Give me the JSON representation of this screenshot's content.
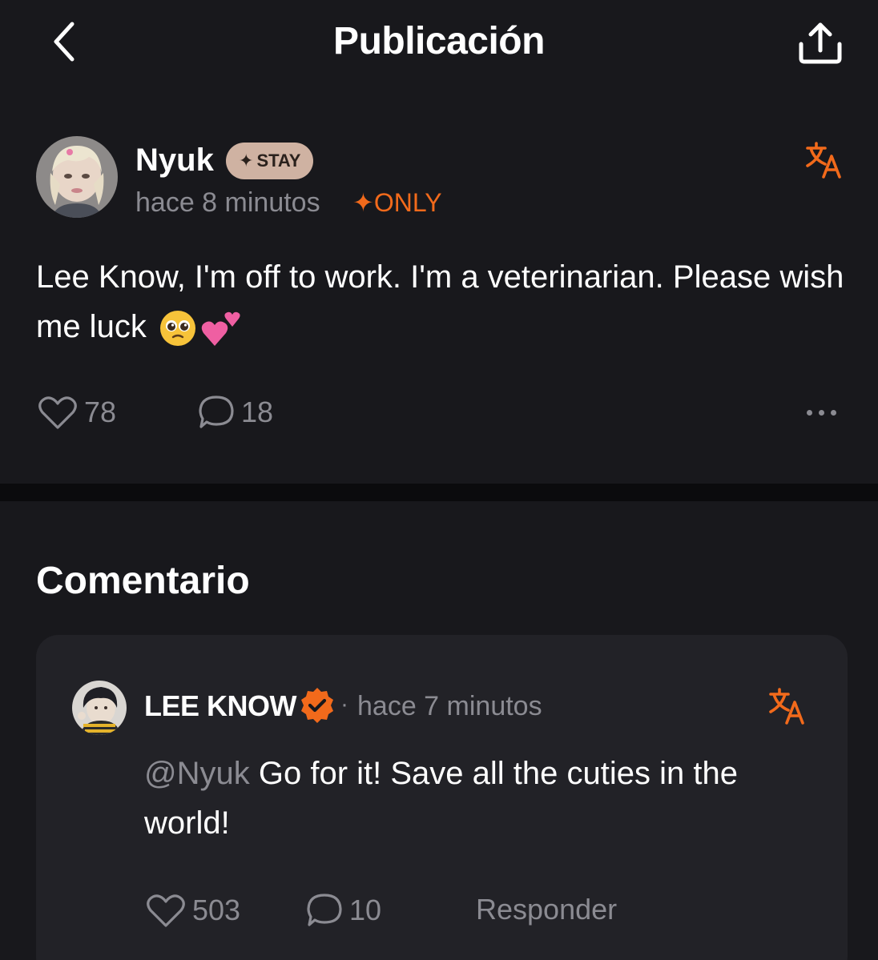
{
  "header": {
    "title": "Publicación"
  },
  "post": {
    "author": "Nyuk",
    "badge": "STAY",
    "time": "hace 8 minutos",
    "visibility": "ONLY",
    "text": "Lee Know, I'm off to work. I'm a veterinarian. Please wish me luck",
    "likes": "78",
    "comments": "18"
  },
  "section": {
    "title": "Comentario"
  },
  "comment": {
    "author": "LEE KNOW",
    "separator": "·",
    "time": "hace 7 minutos",
    "mention": "@Nyuk",
    "text": "Go for it! Save all the cuties in the world!",
    "likes": "503",
    "comments": "10",
    "reply_label": "Responder"
  },
  "colors": {
    "background": "#18181c",
    "accent": "#f26a1b",
    "muted": "#8b8b92",
    "badge": "#cfb2a2",
    "card": "#222227"
  },
  "icons": [
    "chevron-left-icon",
    "share-icon",
    "translate-icon",
    "heart-icon",
    "comment-icon",
    "more-icon",
    "verified-icon",
    "sparkle-icon"
  ]
}
